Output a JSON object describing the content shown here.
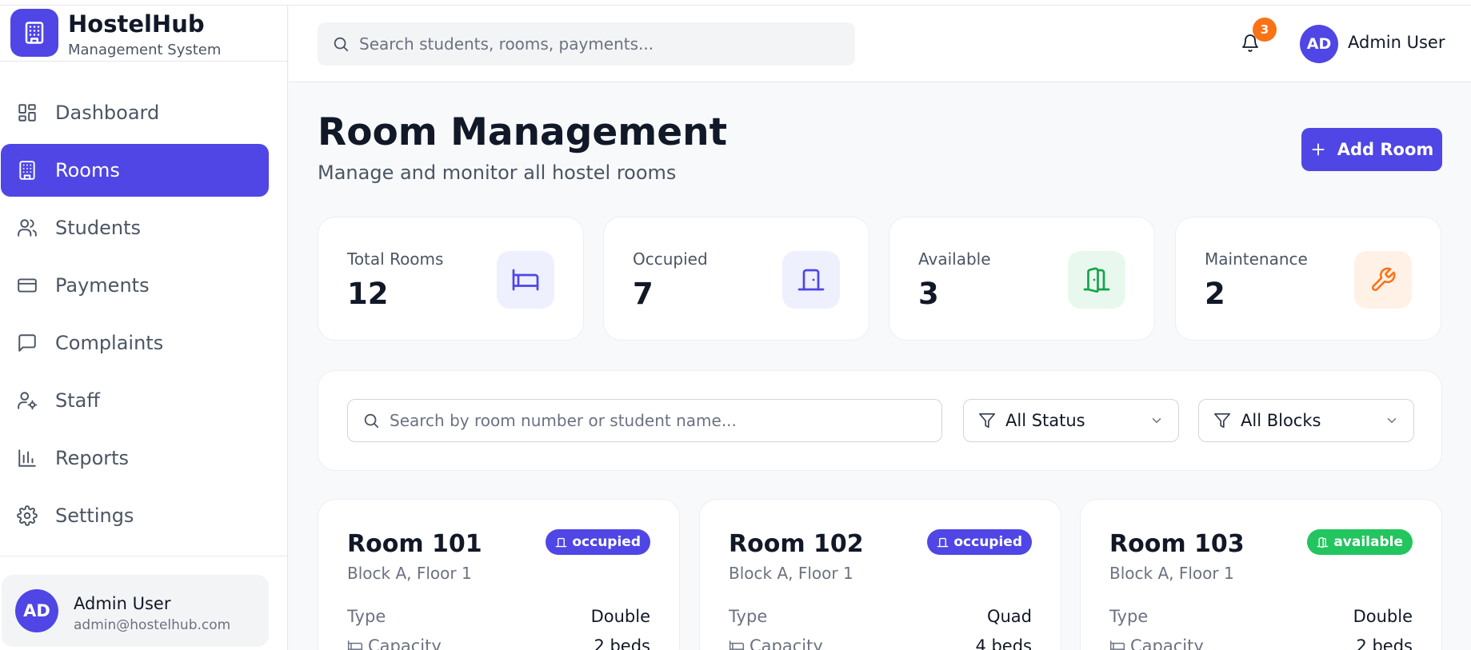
{
  "brand": {
    "title": "HostelHub",
    "subtitle": "Management System"
  },
  "sidebar": {
    "items": [
      {
        "label": "Dashboard",
        "icon": "dashboard-icon"
      },
      {
        "label": "Rooms",
        "icon": "building-icon",
        "active": true
      },
      {
        "label": "Students",
        "icon": "users-icon"
      },
      {
        "label": "Payments",
        "icon": "credit-card-icon"
      },
      {
        "label": "Complaints",
        "icon": "message-square-icon"
      },
      {
        "label": "Staff",
        "icon": "user-cog-icon"
      },
      {
        "label": "Reports",
        "icon": "bar-chart-icon"
      },
      {
        "label": "Settings",
        "icon": "gear-icon"
      }
    ],
    "user": {
      "initials": "AD",
      "name": "Admin User",
      "email": "admin@hostelhub.com"
    }
  },
  "header": {
    "search_placeholder": "Search students, rooms, payments...",
    "notification_count": "3",
    "user_initials": "AD",
    "user_name": "Admin User"
  },
  "main": {
    "title": "Room Management",
    "subtitle": "Manage and monitor all hostel rooms",
    "add_button": "Add Room",
    "stats": [
      {
        "label": "Total Rooms",
        "value": "12",
        "icon": "bed-icon",
        "color": "#4f46e5",
        "bg": "#eef0fe"
      },
      {
        "label": "Occupied",
        "value": "7",
        "icon": "door-closed-icon",
        "color": "#4f46e5",
        "bg": "#eef0fe"
      },
      {
        "label": "Available",
        "value": "3",
        "icon": "door-open-icon",
        "color": "#16a34a",
        "bg": "#e8f8ee"
      },
      {
        "label": "Maintenance",
        "value": "2",
        "icon": "wrench-icon",
        "color": "#f97316",
        "bg": "#fff1e6"
      }
    ],
    "filters": {
      "search_placeholder": "Search by room number or student name...",
      "status": "All Status",
      "blocks": "All Blocks"
    },
    "rooms": [
      {
        "name": "Room 101",
        "location": "Block A, Floor 1",
        "status": "occupied",
        "status_color": "#4f46e5",
        "type_label": "Type",
        "type": "Double",
        "capacity_label": "Capacity",
        "capacity": "2 beds"
      },
      {
        "name": "Room 102",
        "location": "Block A, Floor 1",
        "status": "occupied",
        "status_color": "#4f46e5",
        "type_label": "Type",
        "type": "Quad",
        "capacity_label": "Capacity",
        "capacity": "4 beds"
      },
      {
        "name": "Room 103",
        "location": "Block A, Floor 1",
        "status": "available",
        "status_color": "#22c55e",
        "type_label": "Type",
        "type": "Double",
        "capacity_label": "Capacity",
        "capacity": "2 beds"
      }
    ]
  },
  "colors": {
    "accent": "#4f46e5",
    "notification": "#f97316",
    "available": "#22c55e"
  }
}
